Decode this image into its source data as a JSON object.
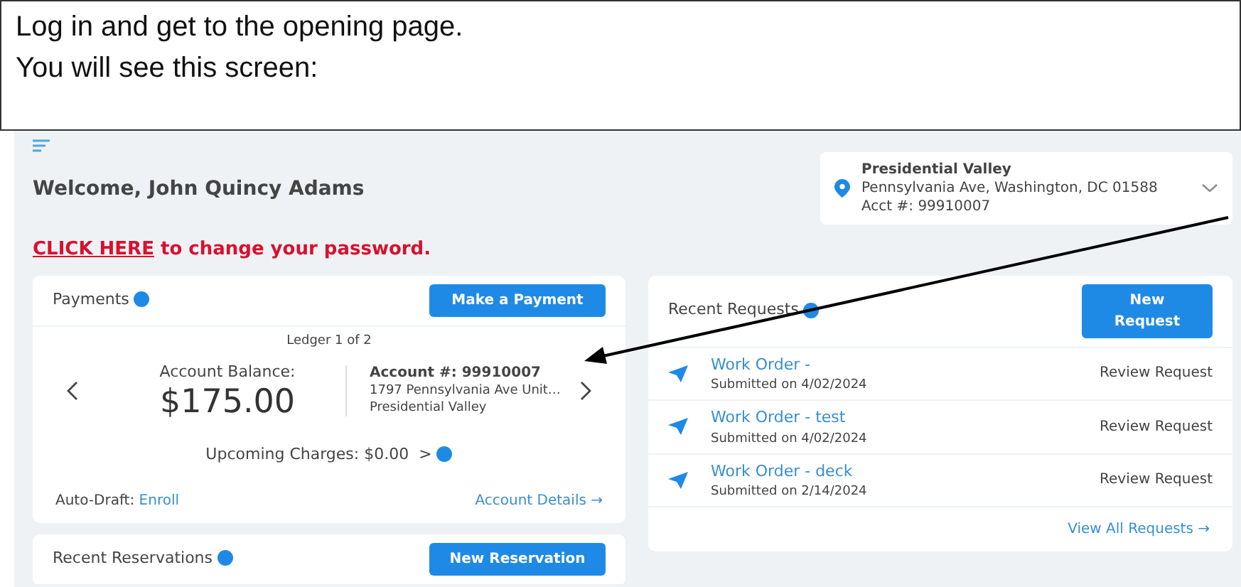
{
  "instructions": [
    "Log in and get to the opening page.",
    "You will see this screen:"
  ],
  "welcome": "Welcome, John Quincy Adams",
  "property": {
    "name": "Presidential Valley",
    "address": "Pennsylvania Ave, Washington, DC 01588",
    "account": "Acct #: 99910007"
  },
  "password_notice": {
    "link": "CLICK HERE",
    "text": "to change your password."
  },
  "payments": {
    "title": "Payments",
    "button": "Make a Payment",
    "ledger": "Ledger 1 of 2",
    "balance_label": "Account Balance:",
    "balance": "$175.00",
    "account_number": "Account #: 99910007",
    "address": "1797 Pennsylvania Ave Unit…",
    "community": "Presidential Valley",
    "upcoming": "Upcoming Charges: $0.00  >",
    "auto_draft_label": "Auto-Draft:",
    "auto_draft_link": "Enroll",
    "details_link": "Account Details →"
  },
  "requests": {
    "title": "Recent Requests",
    "button": "New Request",
    "items": [
      {
        "title": "Work Order -",
        "date": "Submitted on 4/02/2024",
        "action": "Review Request"
      },
      {
        "title": "Work Order - test",
        "date": "Submitted on 4/02/2024",
        "action": "Review Request"
      },
      {
        "title": "Work Order - deck",
        "date": "Submitted on 2/14/2024",
        "action": "Review Request"
      }
    ],
    "view_all": "View All Requests →"
  },
  "reservations": {
    "title": "Recent Reservations",
    "button": "New Reservation"
  }
}
